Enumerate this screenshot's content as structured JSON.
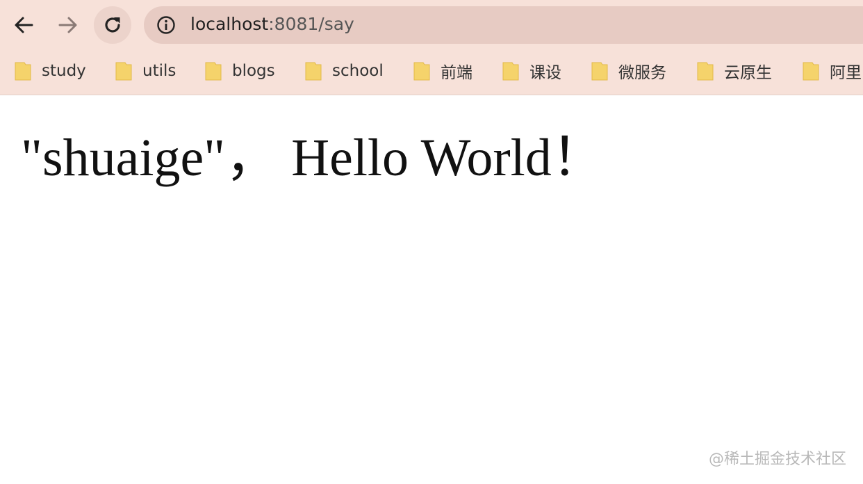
{
  "browser": {
    "url_host": "localhost",
    "url_path": ":8081/say",
    "icons": {
      "back": "arrow-left-icon",
      "forward": "arrow-right-icon",
      "reload": "reload-icon",
      "site_info": "info-icon",
      "bookmark_folder": "folder-icon"
    },
    "colors": {
      "chrome_background": "#f7e1d9",
      "address_bar": "#e7cbc3",
      "folder": "#f5d36b"
    }
  },
  "bookmarks": [
    {
      "label": "study"
    },
    {
      "label": "utils"
    },
    {
      "label": "blogs"
    },
    {
      "label": "school"
    },
    {
      "label": "前端"
    },
    {
      "label": "课设"
    },
    {
      "label": "微服务"
    },
    {
      "label": "云原生"
    },
    {
      "label": "阿里"
    }
  ],
  "page": {
    "greeting": "\"shuaige\"， Hello World！"
  },
  "watermark": "@稀土掘金技术社区"
}
